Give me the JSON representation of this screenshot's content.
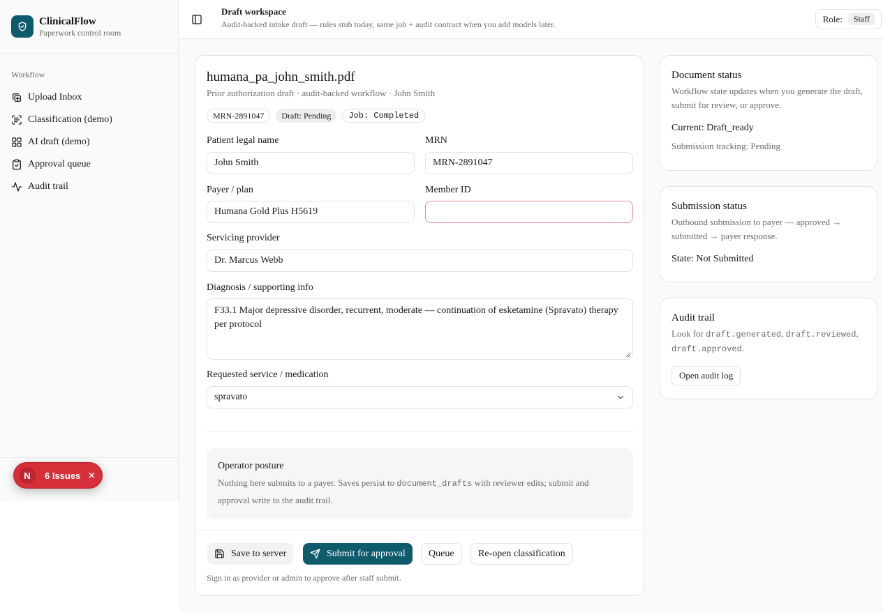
{
  "brand": {
    "name": "ClinicalFlow",
    "subtitle": "Paperwork control room"
  },
  "sidebar": {
    "group_label": "Workflow",
    "items": [
      {
        "label": "Upload Inbox",
        "icon": "copy-upload-icon"
      },
      {
        "label": "Classification (demo)",
        "icon": "scan-text-icon"
      },
      {
        "label": "AI draft (demo)",
        "icon": "layout-grid-icon"
      },
      {
        "label": "Approval queue",
        "icon": "clipboard-check-icon"
      },
      {
        "label": "Audit trail",
        "icon": "activity-icon"
      }
    ]
  },
  "issues_badge": {
    "letter": "N",
    "label": "6 Issues",
    "color": "#d62f3a"
  },
  "header": {
    "title": "Draft workspace",
    "subtitle": "Audit-backed intake draft — rules stub today, same job + audit contract when you add models later.",
    "role_label": "Role:",
    "role_value": "Staff"
  },
  "document": {
    "filename": "humana_pa_john_smith.pdf",
    "subtitle": "Prior authorization draft · audit-backed workflow · John Smith",
    "chips": [
      "MRN-2891047",
      "Draft: Pending",
      "Job: Completed"
    ]
  },
  "form": {
    "patient_label": "Patient legal name",
    "patient_value": "John Smith",
    "mrn_label": "MRN",
    "mrn_value": "MRN-2891047",
    "payer_label": "Payer / plan",
    "payer_value": "Humana Gold Plus H5619",
    "member_label": "Member ID",
    "member_value": "",
    "provider_label": "Servicing provider",
    "provider_value": "Dr. Marcus Webb",
    "diagnosis_label": "Diagnosis / supporting info",
    "diagnosis_value": "F33.1 Major depressive disorder, recurrent, moderate — continuation of esketamine (Spravato) therapy per protocol",
    "service_label": "Requested service / medication",
    "service_value": "spravato"
  },
  "posture": {
    "title": "Operator posture",
    "text_a": "Nothing here submits to a payer. Saves persist to",
    "code": "document_drafts",
    "text_b": "with reviewer edits; submit and approval write to the audit trail."
  },
  "actions": {
    "save": "Save to server",
    "submit": "Submit for approval",
    "queue": "Queue",
    "reopen": "Re-open classification",
    "footnote": "Sign in as provider or admin to approve after staff submit."
  },
  "doc_status": {
    "title": "Document status",
    "text": "Workflow state updates when you generate the draft, submit for review, or approve.",
    "current": "Current: Draft_ready",
    "tracking": "Submission tracking: Pending"
  },
  "submission_status": {
    "title": "Submission status",
    "text": "Outbound submission to payer — approved → submitted → payer response.",
    "state": "State: Not Submitted"
  },
  "audit": {
    "title": "Audit trail",
    "look_for": "Look for",
    "ev1": "draft.generated",
    "ev2": "draft.reviewed",
    "ev3": "draft.approved",
    "button": "Open audit log"
  },
  "colors": {
    "accent": "#0e5b6b",
    "error_border": "#e88d93"
  }
}
